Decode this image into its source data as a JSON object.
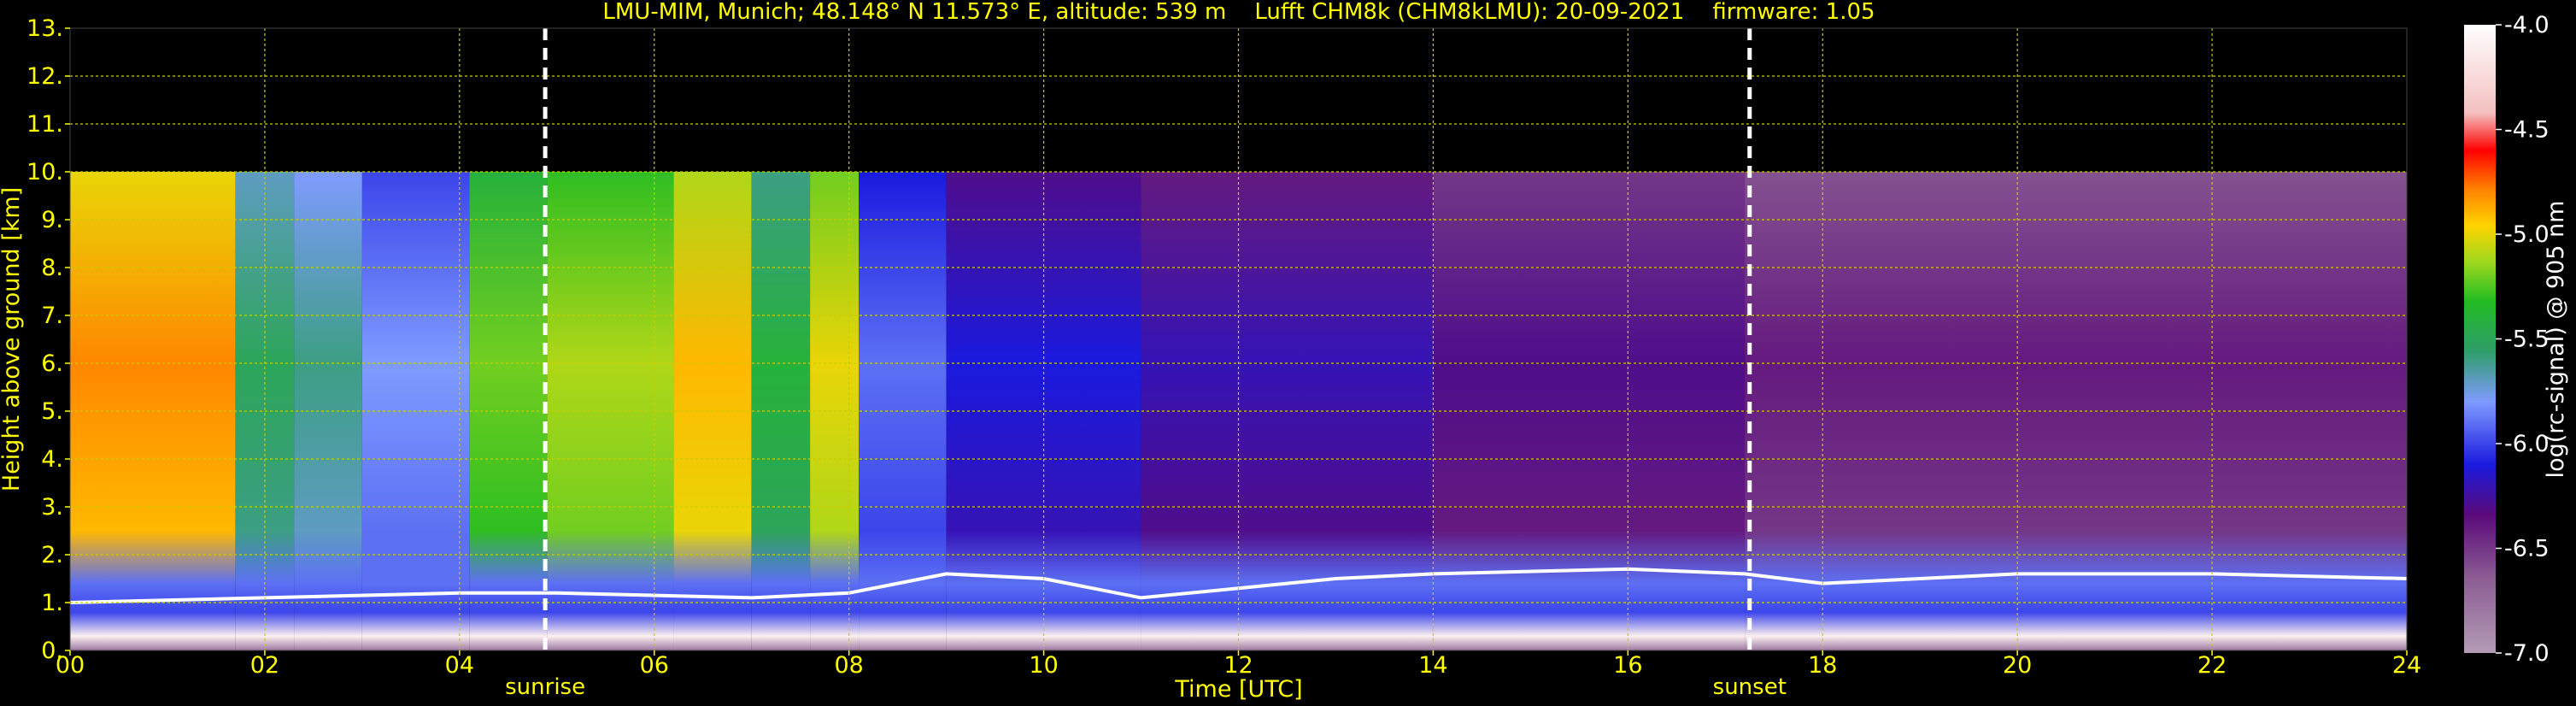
{
  "chart_data": {
    "type": "heatmap",
    "title": "LMU-MIM, Munich; 48.148° N 11.573° E, altitude: 539 m    Lufft CHM8k (CHM8kLMU): 20-09-2021    firmware: 1.05",
    "xlabel": "Time [UTC]",
    "ylabel": "Height above ground [km]",
    "xlim": [
      0,
      24
    ],
    "ylim": [
      0,
      13
    ],
    "x_ticks": [
      "00",
      "02",
      "04",
      "06",
      "08",
      "10",
      "12",
      "14",
      "16",
      "18",
      "20",
      "22",
      "24"
    ],
    "y_ticks": [
      "0.",
      "1.",
      "2.",
      "3.",
      "4.",
      "5.",
      "6.",
      "7.",
      "8.",
      "9.",
      "10.",
      "11.",
      "12.",
      "13."
    ],
    "grid": true,
    "data_top_height_km": 10,
    "colorbar": {
      "label": "log(rc-signal) @ 905 nm",
      "range": [
        -7.0,
        -4.0
      ],
      "ticks": [
        "-4.0",
        "-4.5",
        "-5.0",
        "-5.5",
        "-6.0",
        "-6.5",
        "-7.0"
      ]
    },
    "annotations": [
      {
        "label": "sunrise",
        "time": 4.88
      },
      {
        "label": "sunset",
        "time": 17.25
      }
    ],
    "profile_segments": [
      {
        "t0": 0.0,
        "t1": 1.7,
        "level": -4.8
      },
      {
        "t0": 1.7,
        "t1": 2.3,
        "level": -5.5
      },
      {
        "t0": 2.3,
        "t1": 3.0,
        "level": -5.6
      },
      {
        "t0": 3.0,
        "t1": 4.1,
        "level": -5.8
      },
      {
        "t0": 4.1,
        "t1": 4.9,
        "level": -5.2
      },
      {
        "t0": 4.9,
        "t1": 6.2,
        "level": -5.1
      },
      {
        "t0": 6.2,
        "t1": 7.0,
        "level": -4.9
      },
      {
        "t0": 7.0,
        "t1": 7.6,
        "level": -5.4
      },
      {
        "t0": 7.6,
        "t1": 8.1,
        "level": -5.0
      },
      {
        "t0": 8.1,
        "t1": 9.0,
        "level": -5.9
      },
      {
        "t0": 9.0,
        "t1": 11.0,
        "level": -6.1
      },
      {
        "t0": 11.0,
        "t1": 14.0,
        "level": -6.2
      },
      {
        "t0": 14.0,
        "t1": 17.2,
        "level": -6.3
      },
      {
        "t0": 17.2,
        "t1": 24.0,
        "level": -6.4
      }
    ],
    "boundary_layer_top_km": [
      {
        "t": 0,
        "h": 1.0
      },
      {
        "t": 2,
        "h": 1.1
      },
      {
        "t": 4,
        "h": 1.2
      },
      {
        "t": 5,
        "h": 1.2
      },
      {
        "t": 7,
        "h": 1.1
      },
      {
        "t": 8,
        "h": 1.2
      },
      {
        "t": 9,
        "h": 1.6
      },
      {
        "t": 10,
        "h": 1.5
      },
      {
        "t": 11,
        "h": 1.1
      },
      {
        "t": 12,
        "h": 1.3
      },
      {
        "t": 13,
        "h": 1.5
      },
      {
        "t": 14,
        "h": 1.6
      },
      {
        "t": 16,
        "h": 1.7
      },
      {
        "t": 17.2,
        "h": 1.6
      },
      {
        "t": 18,
        "h": 1.4
      },
      {
        "t": 19,
        "h": 1.5
      },
      {
        "t": 20,
        "h": 1.6
      },
      {
        "t": 22,
        "h": 1.6
      },
      {
        "t": 24,
        "h": 1.5
      }
    ]
  }
}
